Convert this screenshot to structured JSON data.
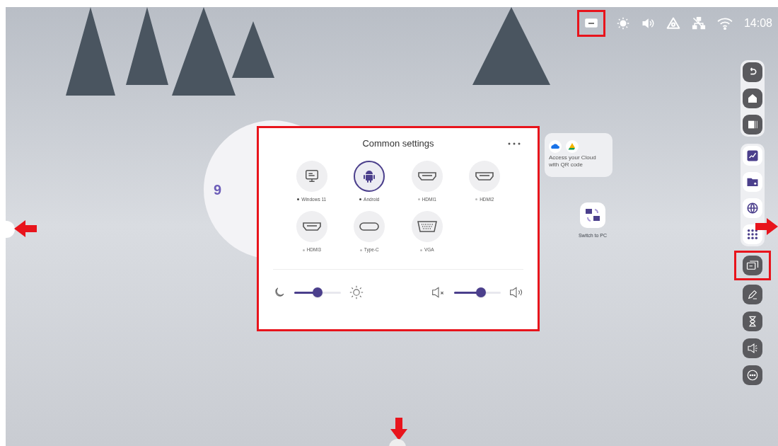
{
  "status_bar": {
    "time": "14:08"
  },
  "clock": {
    "numeral": "9"
  },
  "common_settings": {
    "title": "Common settings",
    "sources": [
      {
        "label": "Windows 11",
        "kind": "monitor",
        "selected": false,
        "connected": true
      },
      {
        "label": "Android",
        "kind": "android",
        "selected": true,
        "connected": true
      },
      {
        "label": "HDMI1",
        "kind": "hdmi",
        "selected": false,
        "connected": false
      },
      {
        "label": "HDMI2",
        "kind": "hdmi",
        "selected": false,
        "connected": false
      },
      {
        "label": "HDMI3",
        "kind": "hdmi",
        "selected": false,
        "connected": false
      },
      {
        "label": "Type-C",
        "kind": "typec",
        "selected": false,
        "connected": false
      },
      {
        "label": "VGA",
        "kind": "vga",
        "selected": false,
        "connected": false
      }
    ],
    "brightness": {
      "level": 0.5
    },
    "volume": {
      "level": 0.58
    }
  },
  "cloud_widget": {
    "text": "Access your Cloud with QR code"
  },
  "desktop_app": {
    "label": "Switch to PC"
  }
}
